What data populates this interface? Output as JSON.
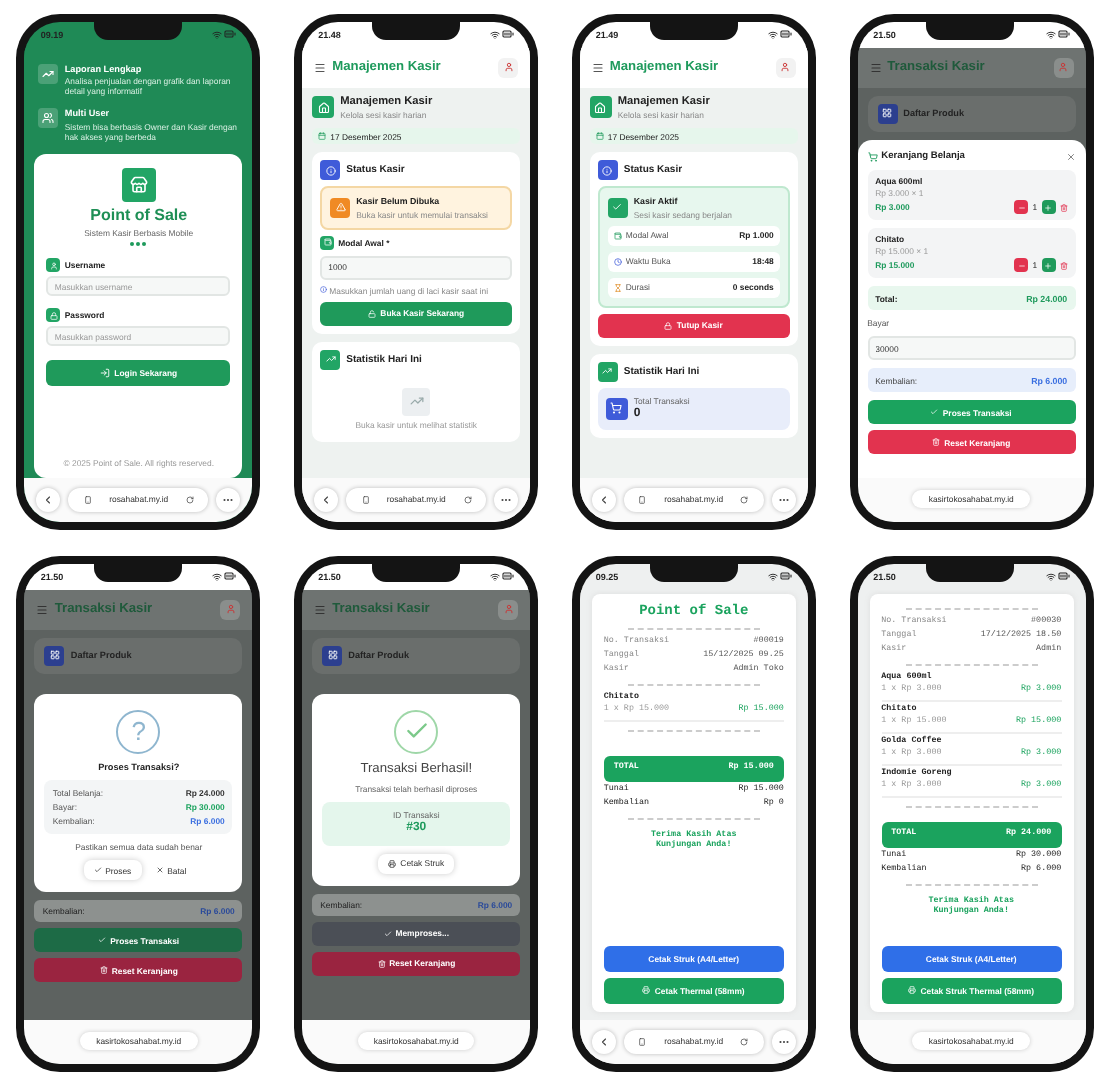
{
  "phones": [
    {
      "kind": "login",
      "time": "09.19",
      "url": "rosahabat.my.id",
      "browser_controls": true,
      "features": [
        {
          "title": "Laporan Lengkap",
          "text": "Analisa penjualan dengan grafik dan laporan detail yang informatif"
        },
        {
          "title": "Multi User",
          "text": "Sistem bisa berbasis Owner dan Kasir dengan hak akses yang berbeda"
        }
      ],
      "title": "Point of Sale",
      "subtitle": "Sistem Kasir Berbasis Mobile",
      "fields": [
        {
          "label": "Username",
          "placeholder": "Masukkan username"
        },
        {
          "label": "Password",
          "placeholder": "Masukkan password"
        }
      ],
      "button": "Login Sekarang",
      "footer": "© 2025 Point of Sale. All rights reserved."
    },
    {
      "kind": "cashier",
      "time": "21.48",
      "url": "rosahabat.my.id",
      "browser_controls": true,
      "header": "Manajemen Kasir",
      "page_title": "Manajemen Kasir",
      "page_subtitle": "Kelola sesi kasir harian",
      "date": "17 Desember 2025",
      "status_title": "Status Kasir",
      "open": false,
      "alert_title": "Kasir Belum Dibuka",
      "alert_text": "Buka kasir untuk memulai transaksi",
      "input_label": "Modal Awal *",
      "input_value": "1000",
      "hint": "Masukkan jumlah uang di laci kasir saat ini",
      "button": "Buka Kasir Sekarang",
      "stats_title": "Statistik Hari Ini",
      "stats_text": "Buka kasir untuk melihat statistik"
    },
    {
      "kind": "cashier",
      "time": "21.49",
      "url": "rosahabat.my.id",
      "browser_controls": true,
      "header": "Manajemen Kasir",
      "page_title": "Manajemen Kasir",
      "page_subtitle": "Kelola sesi kasir harian",
      "date": "17 Desember 2025",
      "status_title": "Status Kasir",
      "open": true,
      "alert_title": "Kasir Aktif",
      "alert_text": "Sesi kasir sedang berjalan",
      "rows": [
        {
          "label": "Modal Awal",
          "value": "Rp 1.000"
        },
        {
          "label": "Waktu Buka",
          "value": "18:48"
        },
        {
          "label": "Durasi",
          "value": "0 seconds"
        }
      ],
      "button": "Tutup Kasir",
      "stats_title": "Statistik Hari Ini",
      "stats_label": "Total Transaksi",
      "stats_value": "0"
    },
    {
      "kind": "cart",
      "time": "21.50",
      "url": "kasirtokosahabat.my.id",
      "browser_controls": false,
      "header": "Transaksi Kasir",
      "section": "Daftar Produk",
      "sheet_title": "Keranjang Belanja",
      "items": [
        {
          "name": "Aqua 600ml",
          "price": "Rp 3.000 × 1",
          "subtotal": "Rp 3.000",
          "qty": "1"
        },
        {
          "name": "Chitato",
          "price": "Rp 15.000 × 1",
          "subtotal": "Rp 15.000",
          "qty": "1"
        }
      ],
      "total_label": "Total:",
      "total": "Rp 24.000",
      "pay_label": "Bayar",
      "pay_value": "30000",
      "change_label": "Kembalian:",
      "change": "Rp 6.000",
      "buttons": [
        {
          "label": "Proses Transaksi",
          "color": "#1ba35e"
        },
        {
          "label": "Reset Keranjang",
          "color": "#e2334f"
        }
      ]
    },
    {
      "kind": "confirm",
      "time": "21.50",
      "url": "kasirtokosahabat.my.id",
      "browser_controls": false,
      "header": "Transaksi Kasir",
      "section": "Daftar Produk",
      "icon_text": "?",
      "title": "Proses Transaksi?",
      "rows": [
        {
          "label": "Total Belanja:",
          "value": "Rp 24.000",
          "color": "#333333"
        },
        {
          "label": "Bayar:",
          "value": "Rp 30.000",
          "color": "#1ba35e"
        },
        {
          "label": "Kembalian:",
          "value": "Rp 6.000",
          "color": "#3b6fe0"
        }
      ],
      "note": "Pastikan semua data sudah benar",
      "actions": [
        "Proses",
        "Batal"
      ],
      "change_label": "Kembalian:",
      "change": "Rp 6.000",
      "buttons": [
        {
          "label": "Proses Transaksi",
          "color": "#1d6b46"
        },
        {
          "label": "Reset Keranjang",
          "color": "#9a2440"
        }
      ]
    },
    {
      "kind": "success",
      "time": "21.50",
      "url": "kasirtokosahabat.my.id",
      "browser_controls": false,
      "header": "Transaksi Kasir",
      "section": "Daftar Produk",
      "title": "Transaksi Berhasil!",
      "text": "Transaksi telah berhasil diproses",
      "id_label": "ID Transaksi",
      "id_value": "#30",
      "action": "Cetak Struk",
      "change_label": "Kembalian:",
      "change": "Rp 6.000",
      "buttons": [
        {
          "label": "Memproses...",
          "color": "#4b4f56"
        },
        {
          "label": "Reset Keranjang",
          "color": "#9a2440"
        }
      ]
    },
    {
      "kind": "receipt",
      "time": "09.25",
      "url": "rosahabat.my.id",
      "browser_controls": true,
      "store": "Point of Sale",
      "meta": [
        {
          "label": "No. Transaksi",
          "value": "#00019"
        },
        {
          "label": "Tanggal",
          "value": "15/12/2025 09.25"
        },
        {
          "label": "Kasir",
          "value": "Admin Toko"
        }
      ],
      "items": [
        {
          "name": "Chitato",
          "detail": "1 x Rp 15.000",
          "subtotal": "Rp 15.000"
        }
      ],
      "total_label": "TOTAL",
      "total": "Rp 15.000",
      "payments": [
        {
          "label": "Tunai",
          "value": "Rp 15.000"
        },
        {
          "label": "Kembalian",
          "value": "Rp 0"
        }
      ],
      "thanks": "Terima Kasih Atas Kunjungan Anda!",
      "buttons": [
        {
          "label": "Cetak Struk (A4/Letter)",
          "color": "#2f6fe8",
          "printer": false
        },
        {
          "label": "Cetak Thermal (58mm)",
          "color": "#1ba35e",
          "printer": true
        }
      ]
    },
    {
      "kind": "receipt",
      "time": "21.50",
      "url": "kasirtokosahabat.my.id",
      "browser_controls": false,
      "meta": [
        {
          "label": "No. Transaksi",
          "value": "#00030"
        },
        {
          "label": "Tanggal",
          "value": "17/12/2025 18.50"
        },
        {
          "label": "Kasir",
          "value": "Admin"
        }
      ],
      "items": [
        {
          "name": "Aqua 600ml",
          "detail": "1 x Rp 3.000",
          "subtotal": "Rp 3.000"
        },
        {
          "name": "Chitato",
          "detail": "1 x Rp 15.000",
          "subtotal": "Rp 15.000"
        },
        {
          "name": "Golda Coffee",
          "detail": "1 x Rp 3.000",
          "subtotal": "Rp 3.000"
        },
        {
          "name": "Indomie Goreng",
          "detail": "1 x Rp 3.000",
          "subtotal": "Rp 3.000"
        }
      ],
      "total_label": "TOTAL",
      "total": "Rp 24.000",
      "payments": [
        {
          "label": "Tunai",
          "value": "Rp 30.000"
        },
        {
          "label": "Kembalian",
          "value": "Rp 6.000"
        }
      ],
      "thanks": "Terima Kasih Atas Kunjungan Anda!",
      "buttons": [
        {
          "label": "Cetak Struk (A4/Letter)",
          "color": "#2f6fe8",
          "printer": false
        },
        {
          "label": "Cetak Struk Thermal (58mm)",
          "color": "#1ba35e",
          "printer": true
        }
      ]
    }
  ]
}
